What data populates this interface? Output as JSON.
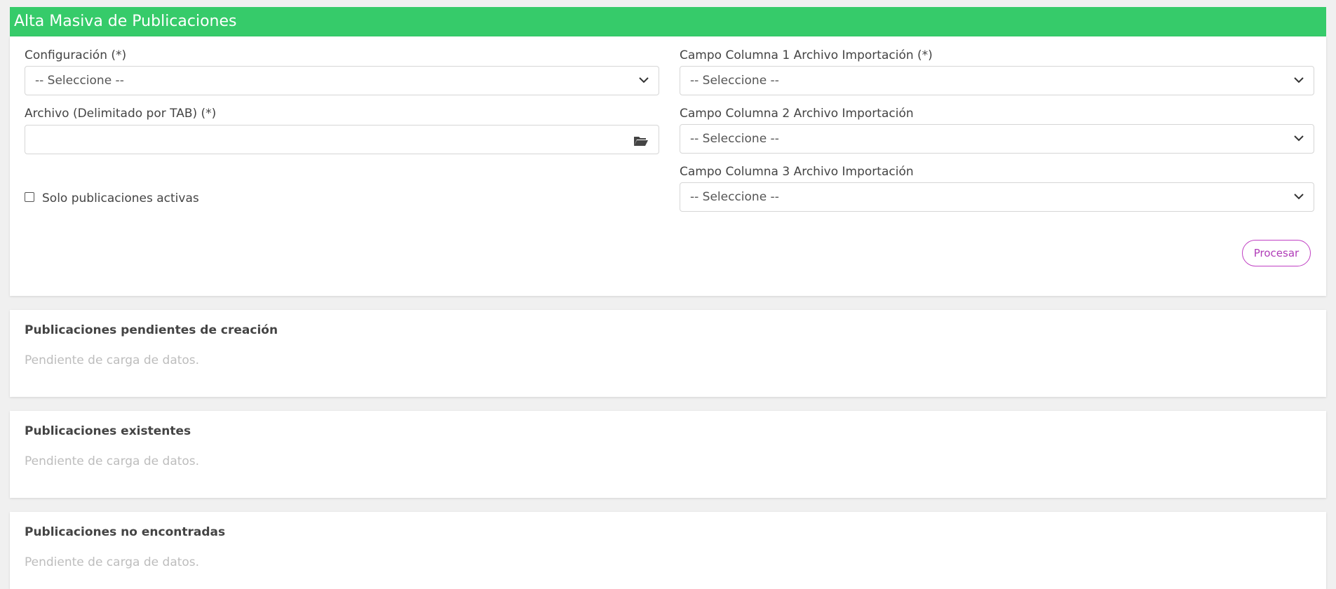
{
  "header": {
    "title": "Alta Masiva de Publicaciones"
  },
  "form": {
    "configuracion": {
      "label": "Configuración (*)",
      "value": "-- Seleccione --"
    },
    "archivo": {
      "label": "Archivo (Delimitado por TAB) (*)",
      "value": ""
    },
    "solo_activas": {
      "label": "Solo publicaciones activas",
      "checked": false
    },
    "campo1": {
      "label": "Campo Columna 1 Archivo Importación (*)",
      "value": "-- Seleccione --"
    },
    "campo2": {
      "label": "Campo Columna 2 Archivo Importación",
      "value": "-- Seleccione --"
    },
    "campo3": {
      "label": "Campo Columna 3 Archivo Importación",
      "value": "-- Seleccione --"
    },
    "procesar_label": "Procesar"
  },
  "sections": {
    "pendientes": {
      "title": "Publicaciones pendientes de creación",
      "empty_text": "Pendiente de carga de datos."
    },
    "existentes": {
      "title": "Publicaciones existentes",
      "empty_text": "Pendiente de carga de datos."
    },
    "no_encontradas": {
      "title": "Publicaciones no encontradas",
      "empty_text": "Pendiente de carga de datos."
    }
  },
  "colors": {
    "header_bg": "#36cb6a",
    "accent_button": "#b03cb8"
  },
  "icons": {
    "select_arrow": "chevron-down-icon",
    "file_browse": "folder-open-icon"
  }
}
